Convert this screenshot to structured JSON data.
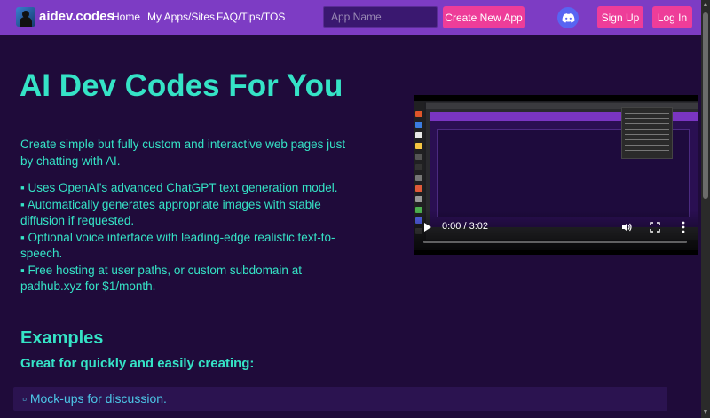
{
  "navbar": {
    "brand": "aidev.codes",
    "links": [
      "Home",
      "My Apps/Sites",
      "FAQ/Tips/TOS"
    ],
    "search_placeholder": "App Name",
    "create_label": "Create New App",
    "signup_label": "Sign Up",
    "login_label": "Log In",
    "bg_color": "#7d3cc4",
    "accent_color": "#ee3d99"
  },
  "hero": {
    "title": "AI Dev Codes For You",
    "description": "Create simple but fully custom and interactive web pages just by chatting with AI.",
    "bullets": [
      "▪ Uses OpenAI's advanced ChatGPT text generation model.",
      "▪ Automatically generates appropriate images with stable diffusion if requested.",
      "▪ Optional voice interface with leading-edge realistic text-to-speech.",
      "▪ Free hosting at user paths, or custom subdomain at padhub.xyz for $1/month."
    ],
    "text_color": "#35e3c6"
  },
  "video": {
    "time": "0:00 / 3:02",
    "play_icon": "play-icon",
    "volume_icon": "volume-icon",
    "fullscreen_icon": "fullscreen-icon",
    "more_icon": "more-vert-icon"
  },
  "examples": {
    "title": "Examples",
    "subtitle": "Great for quickly and easily creating:",
    "items": [
      "▫ Mock-ups for discussion."
    ]
  }
}
